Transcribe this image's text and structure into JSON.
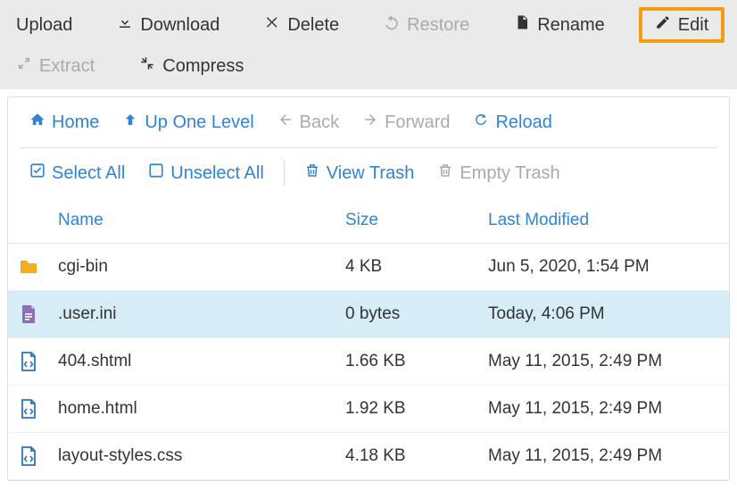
{
  "toolbar": {
    "upload": "Upload",
    "download": "Download",
    "delete": "Delete",
    "restore": "Restore",
    "rename": "Rename",
    "edit": "Edit",
    "extract": "Extract",
    "compress": "Compress"
  },
  "nav": {
    "home": "Home",
    "up": "Up One Level",
    "back": "Back",
    "forward": "Forward",
    "reload": "Reload",
    "select_all": "Select All",
    "unselect_all": "Unselect All",
    "view_trash": "View Trash",
    "empty_trash": "Empty Trash"
  },
  "columns": {
    "name": "Name",
    "size": "Size",
    "modified": "Last Modified"
  },
  "files": [
    {
      "icon": "folder",
      "name": "cgi-bin",
      "size": "4 KB",
      "modified": "Jun 5, 2020, 1:54 PM",
      "selected": false
    },
    {
      "icon": "file-doc",
      "name": ".user.ini",
      "size": "0 bytes",
      "modified": "Today, 4:06 PM",
      "selected": true
    },
    {
      "icon": "file-code",
      "name": "404.shtml",
      "size": "1.66 KB",
      "modified": "May 11, 2015, 2:49 PM",
      "selected": false
    },
    {
      "icon": "file-code",
      "name": "home.html",
      "size": "1.92 KB",
      "modified": "May 11, 2015, 2:49 PM",
      "selected": false
    },
    {
      "icon": "file-code",
      "name": "layout-styles.css",
      "size": "4.18 KB",
      "modified": "May 11, 2015, 2:49 PM",
      "selected": false
    }
  ]
}
